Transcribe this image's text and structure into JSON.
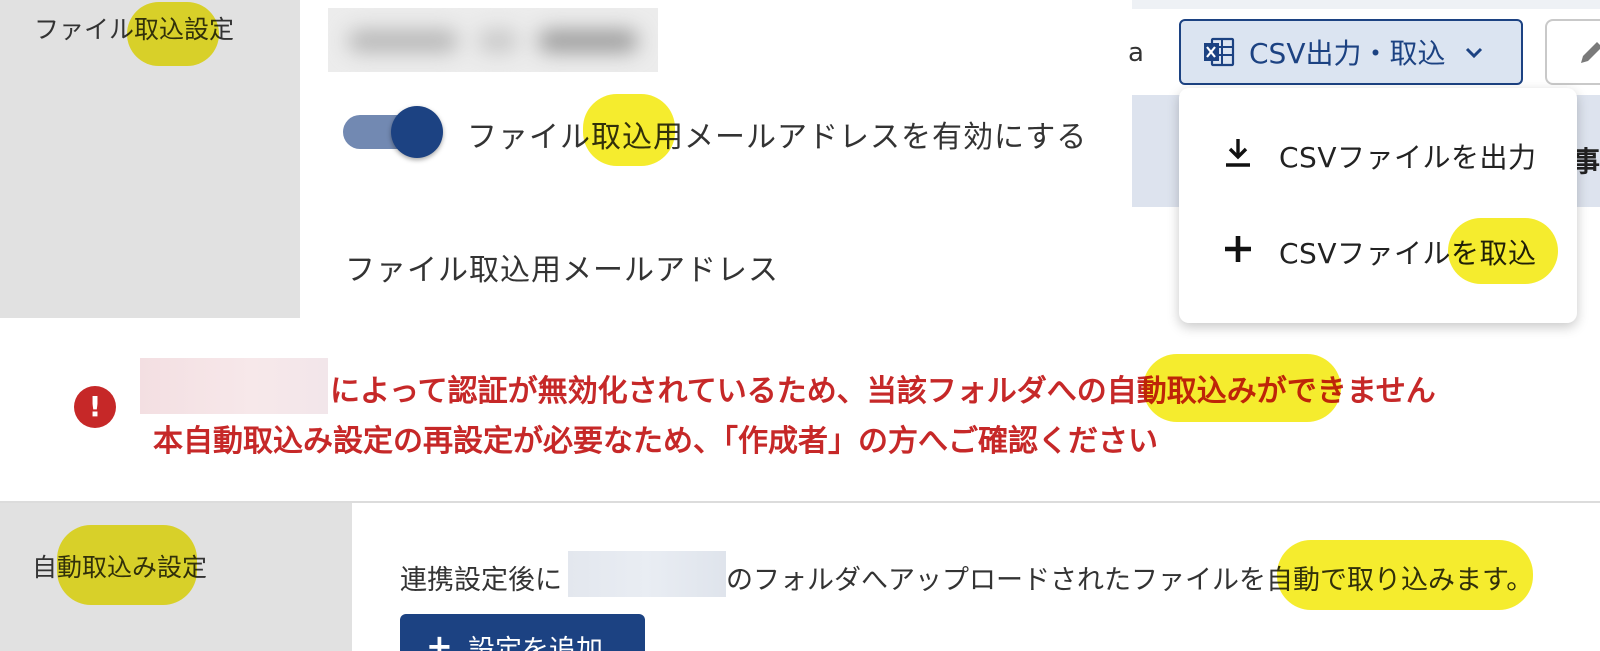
{
  "file_import_section": {
    "label": "ファイル取込設定",
    "toggle_label": "ファイル取込用メールアドレスを有効にする",
    "toggle_on": true,
    "email_label": "ファイル取込用メールアドレス"
  },
  "toolbar": {
    "search_fragment": "a",
    "csv_button_label": "CSV出力・取込",
    "csv_icon": "excel-file-icon",
    "dropdown_icon": "chevron-down-icon",
    "edit_icon": "pencil-icon",
    "table_header_fragment": "事"
  },
  "csv_menu": {
    "items": [
      {
        "label": "CSVファイルを出力",
        "icon": "download-icon"
      },
      {
        "label": "CSVファイルを取込",
        "icon": "plus-icon"
      }
    ]
  },
  "error": {
    "icon": "exclamation-icon",
    "icon_glyph": "!",
    "line1": "によって認証が無効化されているため、当該フォルダへの自動取込みができません",
    "line2": "本自動取込み設定の再設定が必要なため、「作成者」の方へご確認ください"
  },
  "auto_import_section": {
    "label": "自動取込み設定",
    "description_prefix": "連携設定後に",
    "description_suffix": "のフォルダへアップロードされたファイルを自動で取り込みます。",
    "add_button_label": "設定を追加",
    "add_button_icon": "plus-icon"
  },
  "colors": {
    "primary": "#1c4282",
    "error": "#c62828",
    "highlight": "#f3e800",
    "label_cell_bg": "#e1e1e1"
  }
}
